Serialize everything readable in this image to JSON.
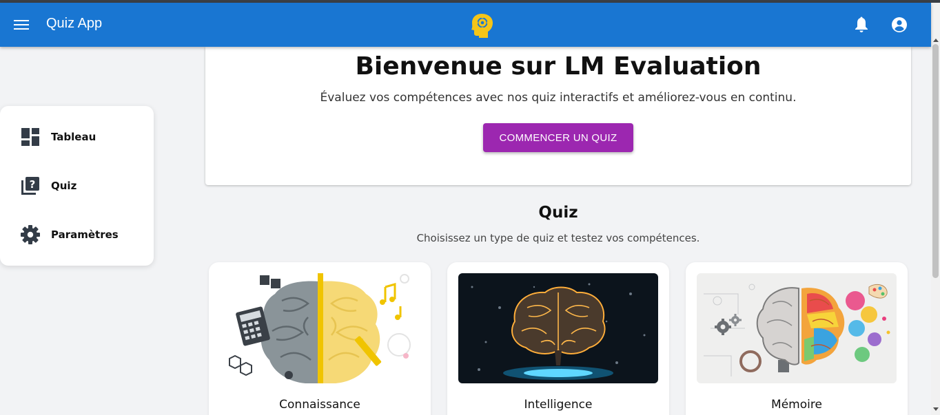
{
  "appbar": {
    "title": "Quiz App"
  },
  "sidebar": {
    "items": [
      {
        "label": "Tableau",
        "icon": "dashboard-icon"
      },
      {
        "label": "Quiz",
        "icon": "quiz-icon"
      },
      {
        "label": "Paramètres",
        "icon": "gear-icon"
      }
    ]
  },
  "hero": {
    "title": "Bienvenue sur LM Evaluation",
    "subtitle": "Évaluez vos compétences avec nos quiz interactifs et améliorez-vous en continu.",
    "cta_label": "COMMENCER UN QUIZ"
  },
  "quiz_section": {
    "title": "Quiz",
    "subtitle": "Choisissez un type de quiz et testez vos compétences.",
    "cards": [
      {
        "label": "Connaissance"
      },
      {
        "label": "Intelligence"
      },
      {
        "label": "Mémoire"
      }
    ]
  },
  "colors": {
    "appbar": "#1976d2",
    "accent_button": "#9c27b0",
    "logo": "#f5c518",
    "background": "#f2f3f5"
  }
}
